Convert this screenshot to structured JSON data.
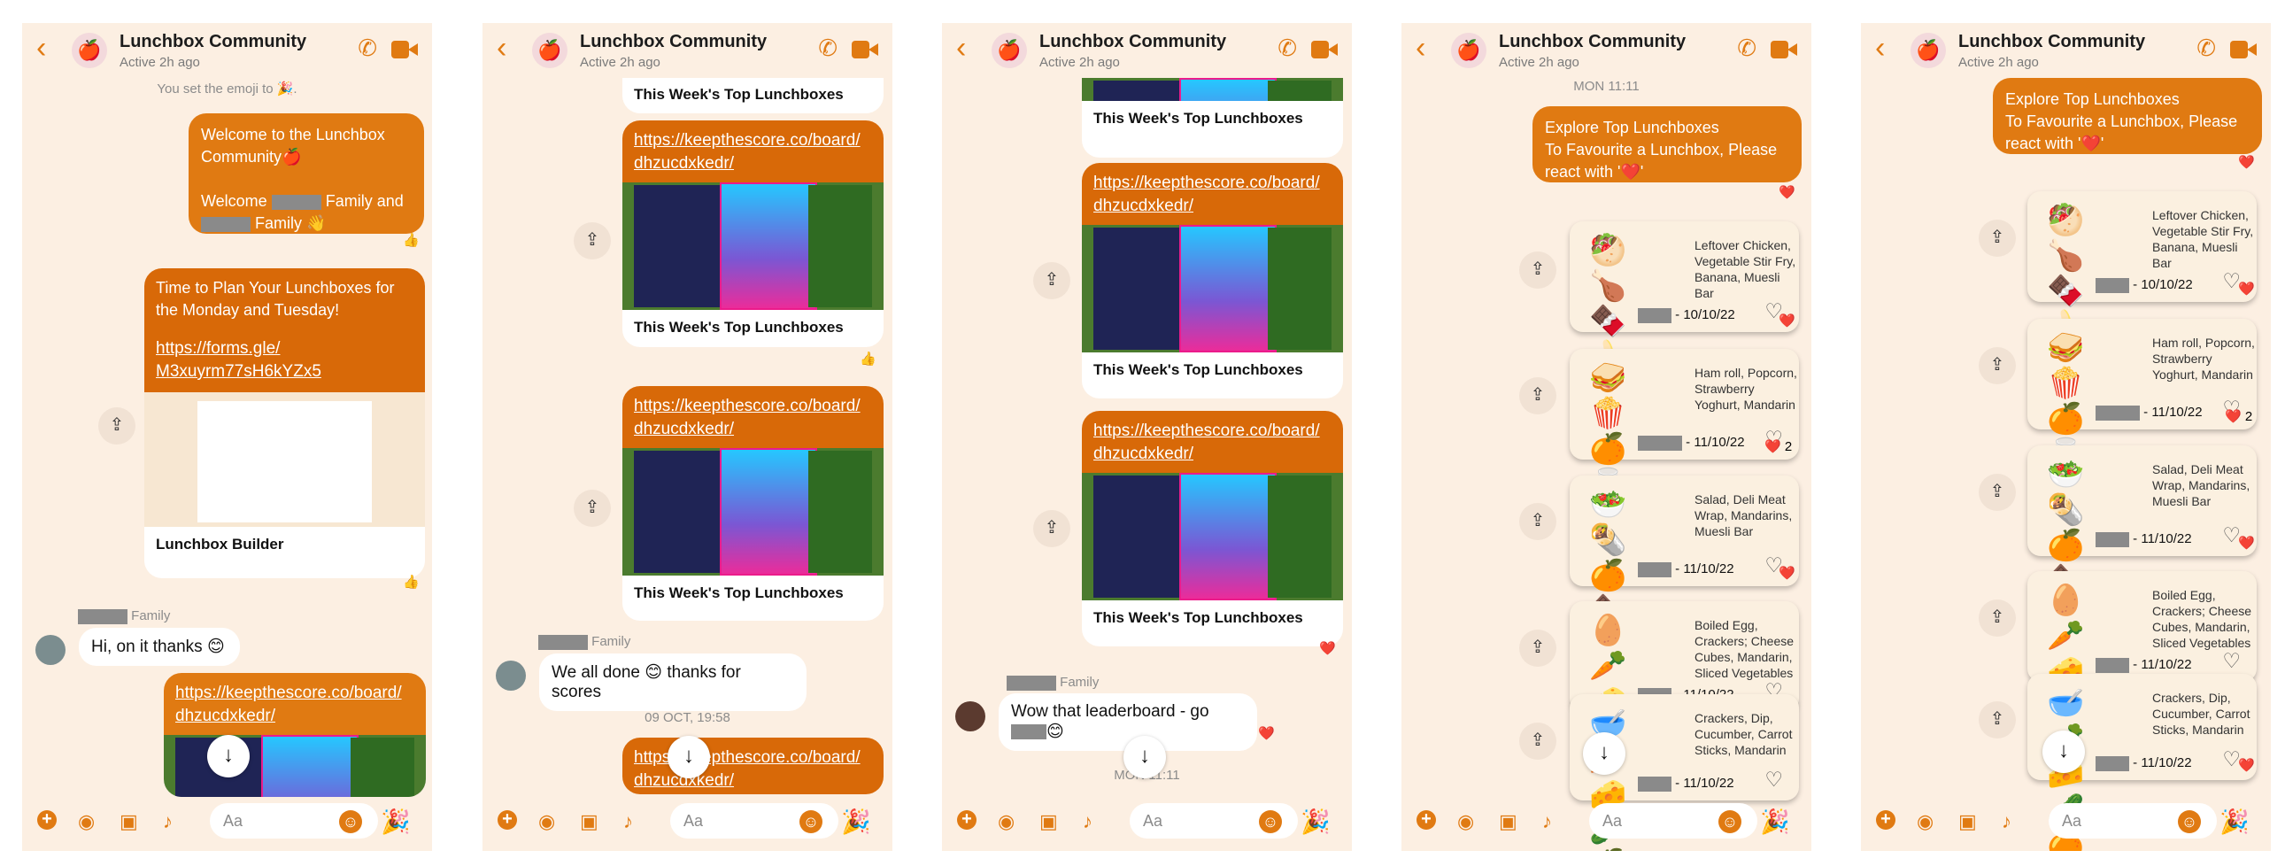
{
  "group": {
    "title": "Lunchbox Community",
    "status": "Active 2h ago",
    "avatar": "🍎"
  },
  "composer": {
    "placeholder": "Aa"
  },
  "icons": {
    "back": "chevron-left-icon",
    "phone": "phone-icon",
    "video": "video-icon",
    "share": "share-icon",
    "scroll": "arrow-down-icon",
    "plus": "plus-icon",
    "camera": "camera-icon",
    "image": "image-icon",
    "mic": "mic-icon",
    "emoji": "smiley-icon",
    "party": "party-icon"
  },
  "p1": {
    "system": "You set the emoji to 🎉.",
    "welcome1": "Welcome to the Lunchbox Community🍎",
    "welcome2": "Welcome",
    "welcome3": "Family and",
    "welcome4": "Family 👋",
    "react1": "👍",
    "plan": "Time to Plan Your Lunchboxes for the Monday and Tuesday!",
    "formlink": "https://forms.gle/ M3xuyrm77sH6kYZx5",
    "preview_caption": "Lunchbox Builder",
    "react2": "👍",
    "family_label": "Family",
    "reply": "Hi, on it thanks 😊",
    "link": "https://keepthescore.co/board/ dhzucdxkedr/"
  },
  "p2": {
    "top_caption": "This Week's Top Lunchboxes",
    "link": "https://keepthescore.co/board/ dhzucdxkedr/",
    "caption1": "This Week's Top Lunchboxes",
    "react1": "👍",
    "caption2": "This Week's Top Lunchboxes",
    "family_label": "Family",
    "reply": "We all done 😊 thanks for scores",
    "date": "09 OCT, 19:58",
    "link_partial": "https://keepthescore.co/board/ dhzucdxkedr/"
  },
  "p3": {
    "top_caption": "This Week's Top Lunchboxes",
    "link": "https://keepthescore.co/board/ dhzucdxkedr/",
    "caption1": "This Week's Top Lunchboxes",
    "caption2": "This Week's Top Lunchboxes",
    "react": "❤️",
    "family_label": "Family",
    "reply": "Wow that leaderboard - go",
    "reply_emoji": "😊",
    "date_partial": "MON 11:11"
  },
  "p4": {
    "date": "MON 11:11",
    "explore1": "Explore Top Lunchboxes",
    "explore2": "To Favourite a Lunchbox, Please react with '❤️'",
    "react": "❤️",
    "react_count": "2",
    "items": [
      {
        "food": "🥙🍗\n🍫🍌",
        "text": "Leftover Chicken, Vegetable Stir Fry, Banana, Muesli Bar",
        "date": "- 10/10/22"
      },
      {
        "food": "🥪🍿\n🍊🥛",
        "text": "Ham roll, Popcorn, Strawberry Yoghurt, Mandarin",
        "date": "- 11/10/22"
      },
      {
        "food": "🥗🌯\n🍊🍫",
        "text": "Salad, Deli Meat Wrap, Mandarins, Muesli Bar",
        "date": "- 11/10/22"
      },
      {
        "food": "🥚🥕🧀\n🧀🍊",
        "text": "Boiled Egg, Crackers; Cheese Cubes, Mandarin, Sliced Vegetables",
        "date": "- 11/10/22"
      },
      {
        "food": "🥣🥕🧀\n🥒🍊",
        "text": "Crackers, Dip, Cucumber, Carrot Sticks, Mandarin",
        "date": "- 11/10/22"
      }
    ]
  },
  "p5": {
    "explore1": "Explore Top Lunchboxes",
    "explore2": "To Favourite a Lunchbox, Please react with '❤️'",
    "react": "❤️",
    "react_count": "2",
    "items": [
      {
        "food": "🥙🍗\n🍫🍌",
        "text": "Leftover Chicken, Vegetable Stir Fry, Banana, Muesli Bar",
        "date": "- 10/10/22"
      },
      {
        "food": "🥪🍿\n🍊🥛",
        "text": "Ham roll, Popcorn, Strawberry Yoghurt, Mandarin",
        "date": "- 11/10/22"
      },
      {
        "food": "🥗🌯\n🍊🍫",
        "text": "Salad, Deli Meat Wrap, Mandarins, Muesli Bar",
        "date": "- 11/10/22"
      },
      {
        "food": "🥚🥕🧀\n🧀🍊",
        "text": "Boiled Egg, Crackers; Cheese Cubes, Mandarin, Sliced Vegetables",
        "date": "- 11/10/22"
      },
      {
        "food": "🥣🥕🧀\n🥒🍊",
        "text": "Crackers, Dip, Cucumber, Carrot Sticks, Mandarin",
        "date": "- 11/10/22"
      }
    ]
  }
}
